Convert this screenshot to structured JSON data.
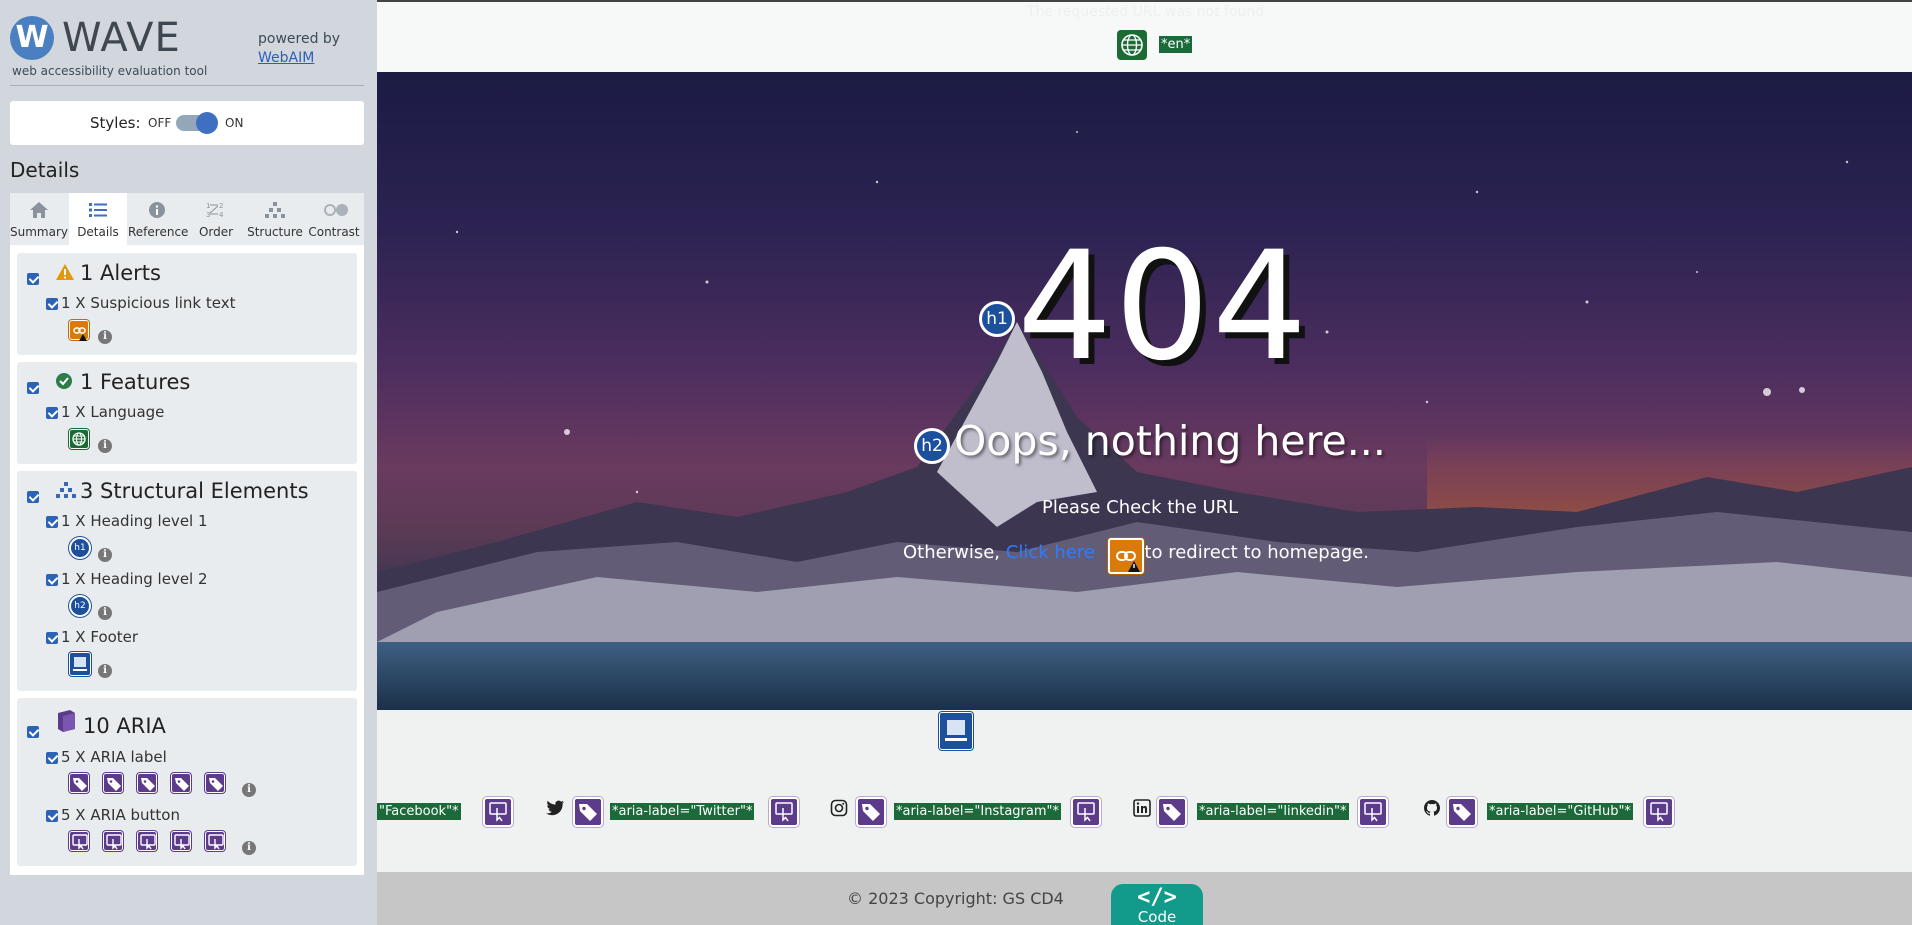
{
  "wave": {
    "logo_letter": "W",
    "logo_word": "WAVE",
    "logo_sub": "web accessibility evaluation tool",
    "powered_by": "powered by",
    "powered_link": "WebAIM",
    "styles_label": "Styles:",
    "styles_off": "OFF",
    "styles_on": "ON",
    "details_heading": "Details",
    "tabs": [
      {
        "label": "Summary",
        "icon": "home-icon"
      },
      {
        "label": "Details",
        "icon": "list-icon",
        "active": true
      },
      {
        "label": "Reference",
        "icon": "info-icon"
      },
      {
        "label": "Order",
        "icon": "order-icon"
      },
      {
        "label": "Structure",
        "icon": "structure-icon"
      },
      {
        "label": "Contrast",
        "icon": "contrast-icon"
      }
    ],
    "groups": {
      "alerts": {
        "title": "1 Alerts",
        "items": [
          {
            "label": "1 X Suspicious link text"
          }
        ]
      },
      "features": {
        "title": "1 Features",
        "items": [
          {
            "label": "1 X Language"
          }
        ]
      },
      "structural": {
        "title": "3 Structural Elements",
        "items": [
          {
            "label": "1 X Heading level 1",
            "badge": "h1"
          },
          {
            "label": "1 X Heading level 2",
            "badge": "h2"
          },
          {
            "label": "1 X Footer"
          }
        ]
      },
      "aria": {
        "title": "10 ARIA",
        "items": [
          {
            "label": "5 X ARIA label"
          },
          {
            "label": "5 X ARIA button"
          }
        ]
      }
    },
    "info_glyph": "i"
  },
  "page": {
    "topbar_faint_text": "The requested URL was not found",
    "lang_tag": "*en*",
    "h1_badge": "h1",
    "h2_badge": "h2",
    "heading_404": "404",
    "heading_oops": "Oops, nothing here...",
    "check_url": "Please Check the URL",
    "otherwise_prefix": "Otherwise,",
    "click_here": "Click here",
    "otherwise_suffix": "to redirect to homepage.",
    "aria_tags": {
      "facebook": "\"Facebook\"*",
      "twitter": "*aria-label=\"Twitter\"*",
      "instagram": "*aria-label=\"Instagram\"*",
      "linkedin": "*aria-label=\"linkedin\"*",
      "github": "*aria-label=\"GitHub\"*"
    },
    "copyright": "© 2023 Copyright: GS CD4",
    "code_glyph": "</>",
    "code_label": "Code"
  },
  "colors": {
    "wave_blue": "#3f6fc0",
    "alert_orange": "#d97a0a",
    "feature_green": "#1c6b35",
    "aria_purple": "#5c3b8b",
    "code_teal": "#129a8b"
  }
}
